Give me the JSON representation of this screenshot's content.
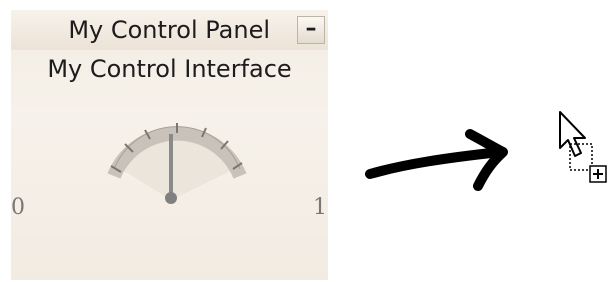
{
  "panel": {
    "title": "My Control Panel",
    "collapse_label": "–",
    "interface_label": "My Control Interface"
  },
  "gauge": {
    "min_label": "0",
    "max_label": "1",
    "value": 0.5
  },
  "icons": {
    "arrow": "right-arrow-icon",
    "cursor": "drag-add-cursor-icon"
  },
  "colors": {
    "panel_bg": "#f4eee6",
    "gauge_arc": "#c9c2ba",
    "needle": "#8a8a8a"
  }
}
